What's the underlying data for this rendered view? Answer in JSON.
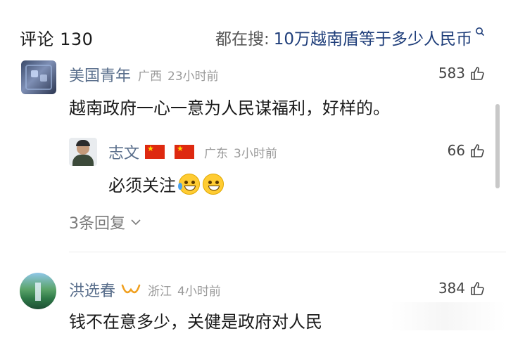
{
  "header": {
    "title": "评论 130",
    "search_prefix": "都在搜:",
    "search_query": "10万越南盾等于多少人民币"
  },
  "comments": [
    {
      "name": "美国青年",
      "location": "广西",
      "time": "23小时前",
      "likes": "583",
      "text": "越南政府一心一意为人民谋福利，好样的。",
      "reply": {
        "name": "志文",
        "location": "广东",
        "time": "3小时前",
        "likes": "66",
        "text": "必须关注"
      },
      "replies_label": "3条回复"
    },
    {
      "name": "洪选春",
      "location": "浙江",
      "time": "4小时前",
      "likes": "384",
      "text": "钱不在意多少，关健是政府对人民"
    }
  ],
  "colors": {
    "name": "#5a6f8c",
    "search_query": "#1f3e7a",
    "meta": "#9a9a9a",
    "flag_red": "#de2910"
  },
  "icons": [
    "search-icon",
    "thumbs-up-icon",
    "chevron-down-icon",
    "china-flag-icon",
    "vip-badge-icon",
    "laughing-crying-emoji",
    "grinning-emoji"
  ]
}
